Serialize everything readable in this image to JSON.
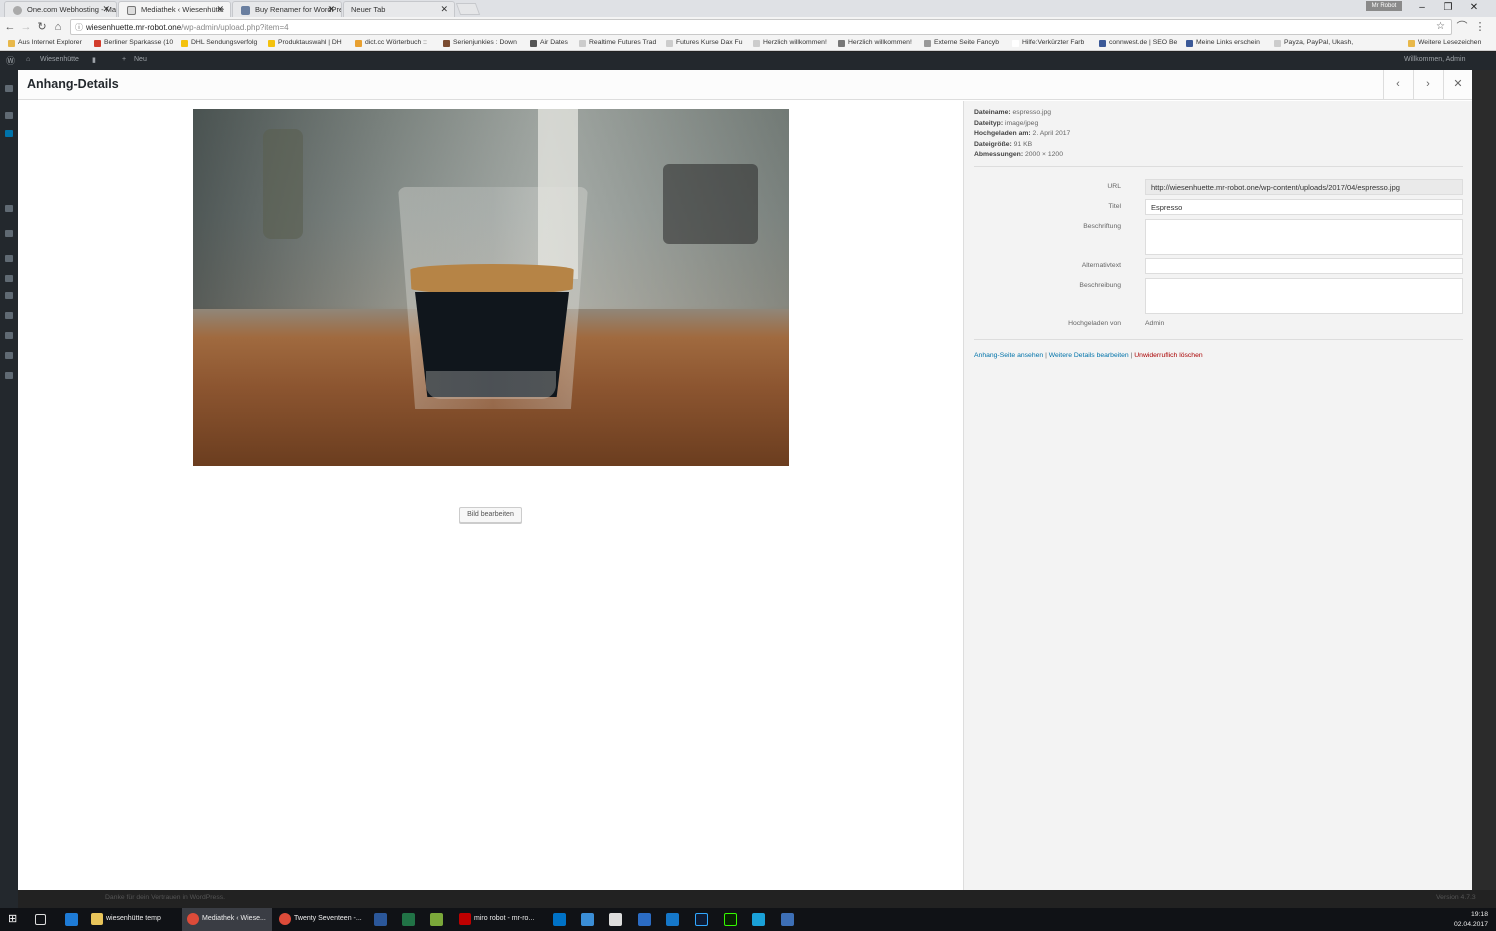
{
  "browser": {
    "tabs": [
      {
        "label": "One.com Webhosting - Ma",
        "active": false
      },
      {
        "label": "Mediathek ‹ Wiesenhütte",
        "active": true
      },
      {
        "label": "Buy Renamer for WordPre",
        "active": false
      },
      {
        "label": "Neuer Tab",
        "active": false
      }
    ],
    "user_badge": "Mr Robot",
    "url_host": "wiesenhuette.mr-robot.one",
    "url_path": "/wp-admin/upload.php?item=4",
    "bookmarks": [
      "Aus Internet Explorer",
      "Berliner Sparkasse (10",
      "DHL Sendungsverfolg",
      "Produktauswahl | DH",
      "dict.cc Wörterbuch ::",
      "Serienjunkies : Down",
      "Air Dates",
      "Realtime Futures Trad",
      "Futures Kurse Dax Fu",
      "Herzlich willkommen!",
      "Herzlich willkommen!",
      "Externe Seite Fancyb",
      "Hilfe:Verkürzter Farb",
      "connwest.de | SEO Be",
      "Meine Links erschein",
      "Payza, PayPal, Ukash,",
      "Weitere Lesezeichen"
    ]
  },
  "wp": {
    "site_name": "Wiesenhütte",
    "new_label": "Neu",
    "greeting": "Willkommen, Admin",
    "footer_left": "Danke für dein Vertrauen in WordPress.",
    "footer_right": "Version 4.7.3"
  },
  "modal": {
    "title": "Anhang-Details",
    "edit_image": "Bild bearbeiten",
    "meta": {
      "filename_label": "Dateiname:",
      "filename": "espresso.jpg",
      "filetype_label": "Dateityp:",
      "filetype": "image/jpeg",
      "uploaded_label": "Hochgeladen am:",
      "uploaded": "2. April 2017",
      "filesize_label": "Dateigröße:",
      "filesize": "91 KB",
      "dims_label": "Abmessungen:",
      "dims": "2000 × 1200"
    },
    "fields": {
      "url_label": "URL",
      "url": "http://wiesenhuette.mr-robot.one/wp-content/uploads/2017/04/espresso.jpg",
      "title_label": "Titel",
      "title": "Espresso",
      "caption_label": "Beschriftung",
      "caption": "",
      "alt_label": "Alternativtext",
      "alt": "",
      "desc_label": "Beschreibung",
      "desc": "",
      "uploader_label": "Hochgeladen von",
      "uploader": "Admin"
    },
    "links": {
      "view": "Anhang-Seite ansehen",
      "more": "Weitere Details bearbeiten",
      "delete": "Unwiderruflich löschen"
    }
  },
  "taskbar": {
    "items": [
      {
        "label": "wiesenhütte temp",
        "active": false
      },
      {
        "label": "Mediathek ‹ Wiese...",
        "active": true
      },
      {
        "label": "Twenty Seventeen -...",
        "active": false
      },
      {
        "label": "miro robot - mr-ro...",
        "active": false
      }
    ],
    "time": "19:18",
    "date": "02.04.2017"
  }
}
